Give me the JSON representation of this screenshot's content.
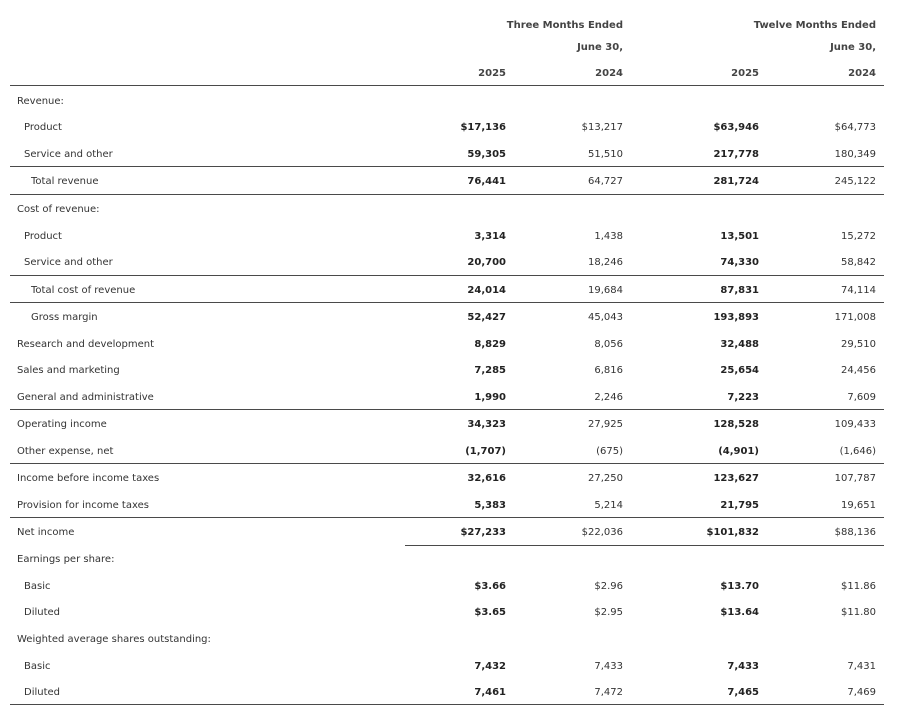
{
  "header": {
    "groups": [
      {
        "line1": "Three Months Ended",
        "line2": "June 30,"
      },
      {
        "line1": "Twelve Months Ended",
        "line2": "June 30,"
      }
    ],
    "years": [
      "2025",
      "2024",
      "2025",
      "2024"
    ]
  },
  "rows": [
    {
      "label": "Revenue:",
      "indent": 0,
      "values": [
        "",
        "",
        "",
        ""
      ]
    },
    {
      "label": "Product",
      "indent": 1,
      "values": [
        "$17,136",
        "$13,217",
        "$63,946",
        "$64,773"
      ]
    },
    {
      "label": "Service and other",
      "indent": 1,
      "values": [
        "59,305",
        "51,510",
        "217,778",
        "180,349"
      ]
    },
    {
      "label": "Total revenue",
      "indent": 2,
      "values": [
        "76,441",
        "64,727",
        "281,724",
        "245,122"
      ]
    },
    {
      "label": "Cost of revenue:",
      "indent": 0,
      "values": [
        "",
        "",
        "",
        ""
      ]
    },
    {
      "label": "Product",
      "indent": 1,
      "values": [
        "3,314",
        "1,438",
        "13,501",
        "15,272"
      ]
    },
    {
      "label": "Service and other",
      "indent": 1,
      "values": [
        "20,700",
        "18,246",
        "74,330",
        "58,842"
      ]
    },
    {
      "label": "Total cost of revenue",
      "indent": 2,
      "values": [
        "24,014",
        "19,684",
        "87,831",
        "74,114"
      ]
    },
    {
      "label": "Gross margin",
      "indent": 2,
      "values": [
        "52,427",
        "45,043",
        "193,893",
        "171,008"
      ]
    },
    {
      "label": "Research and development",
      "indent": 0,
      "values": [
        "8,829",
        "8,056",
        "32,488",
        "29,510"
      ]
    },
    {
      "label": "Sales and marketing",
      "indent": 0,
      "values": [
        "7,285",
        "6,816",
        "25,654",
        "24,456"
      ]
    },
    {
      "label": "General and administrative",
      "indent": 0,
      "values": [
        "1,990",
        "2,246",
        "7,223",
        "7,609"
      ]
    },
    {
      "label": "Operating income",
      "indent": 0,
      "values": [
        "34,323",
        "27,925",
        "128,528",
        "109,433"
      ]
    },
    {
      "label": "Other expense, net",
      "indent": 0,
      "values": [
        "(1,707)",
        "(675)",
        "(4,901)",
        "(1,646)"
      ]
    },
    {
      "label": "Income before income taxes",
      "indent": 0,
      "values": [
        "32,616",
        "27,250",
        "123,627",
        "107,787"
      ]
    },
    {
      "label": "Provision for income taxes",
      "indent": 0,
      "values": [
        "5,383",
        "5,214",
        "21,795",
        "19,651"
      ]
    },
    {
      "label": "Net income",
      "indent": 0,
      "values": [
        "$27,233",
        "$22,036",
        "$101,832",
        "$88,136"
      ]
    },
    {
      "label": "Earnings per share:",
      "indent": 0,
      "values": [
        "",
        "",
        "",
        ""
      ]
    },
    {
      "label": "Basic",
      "indent": 1,
      "values": [
        "$3.66",
        "$2.96",
        "$13.70",
        "$11.86"
      ]
    },
    {
      "label": "Diluted",
      "indent": 1,
      "values": [
        "$3.65",
        "$2.95",
        "$13.64",
        "$11.80"
      ]
    },
    {
      "label": "Weighted average shares outstanding:",
      "indent": 0,
      "values": [
        "",
        "",
        "",
        ""
      ]
    },
    {
      "label": "Basic",
      "indent": 1,
      "values": [
        "7,432",
        "7,433",
        "7,433",
        "7,431"
      ]
    },
    {
      "label": "Diluted",
      "indent": 1,
      "values": [
        "7,461",
        "7,472",
        "7,465",
        "7,469"
      ]
    }
  ]
}
